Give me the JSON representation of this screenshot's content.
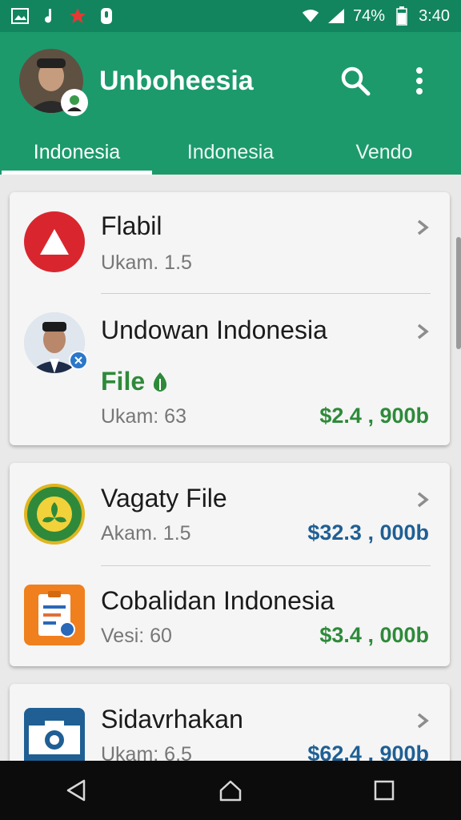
{
  "status_bar": {
    "battery": "74%",
    "time": "3:40",
    "icons": [
      "gallery-icon",
      "music-note-icon",
      "star-icon",
      "usb-icon",
      "wifi-icon",
      "signal-icon",
      "battery-icon"
    ]
  },
  "app_bar": {
    "title": "Unboheesia",
    "actions": [
      "search-icon",
      "more-vert-icon"
    ]
  },
  "tabs": [
    {
      "label": "Indonesia",
      "active": true
    },
    {
      "label": "Indonesia",
      "active": false
    },
    {
      "label": "Vendo",
      "active": false
    }
  ],
  "cards": [
    {
      "items": [
        {
          "title": "Flabil",
          "subtitle": "Ukam. 1.5",
          "icon": "warning-triangle-icon"
        },
        {
          "title": "Undowan Indonesia",
          "file_label": "File",
          "subtitle": "Ukam: 63",
          "price": "$2.4 , 900b",
          "icon": "person-avatar-icon"
        }
      ]
    },
    {
      "items": [
        {
          "title": "Vagaty File",
          "subtitle": "Akam. 1.5",
          "price": "$32.3 , 000b",
          "icon": "leaf-logo-icon"
        },
        {
          "title": "Cobalidan Indonesia",
          "subtitle": "Vesi: 60",
          "price": "$3.4 , 000b",
          "icon": "clipboard-icon"
        }
      ]
    },
    {
      "items": [
        {
          "title": "Sidavrhakan",
          "subtitle": "Ukam: 6.5",
          "price": "$62.4 , 900b",
          "icon": "camera-icon"
        }
      ]
    }
  ],
  "colors": {
    "primary": "#1c9a6c",
    "primary_dark": "#12855e",
    "price_green": "#2e8a3a",
    "price_blue": "#1f5f94",
    "alert_red": "#d9262e"
  },
  "nav_bar": [
    "back-icon",
    "home-icon",
    "recents-icon"
  ]
}
